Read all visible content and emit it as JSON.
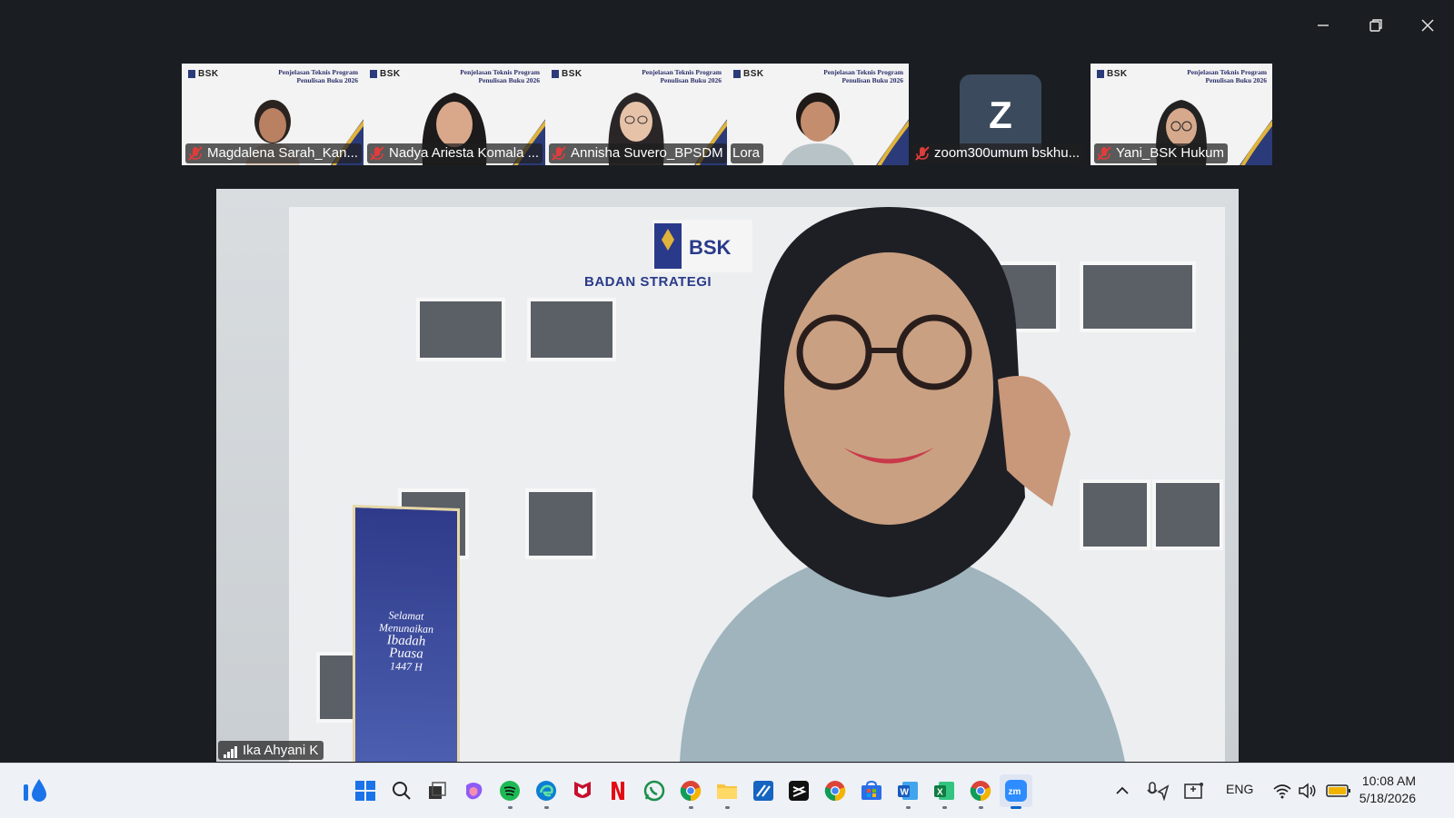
{
  "window": {
    "minimize_icon": "minimize-icon",
    "maximize_icon": "restore-icon",
    "close_icon": "close-icon"
  },
  "slide": {
    "logo": "BSK",
    "title_line1": "Penjelasan Teknis Program",
    "title_line2": "Penulisan Buku 2026"
  },
  "participants": [
    {
      "name": "Magdalena Sarah_Kan...",
      "muted": true
    },
    {
      "name": "Nadya Ariesta Komala ...",
      "muted": true
    },
    {
      "name": "Annisha Suvero_BPSDM",
      "muted": true
    },
    {
      "name": "Lora",
      "muted": false
    },
    {
      "name": "zoom300umum bskhu...",
      "muted": true,
      "avatar_letter": "Z"
    },
    {
      "name": "Yani_BSK Hukum",
      "muted": true
    }
  ],
  "speaker": {
    "name": "Ika Ahyani K",
    "building_sign": "BADAN STRATEGI",
    "building_logo": "BSK",
    "banner_text_1": "Selamat",
    "banner_text_2": "Menunaikan",
    "banner_text_3": "Ibadah",
    "banner_text_4": "Puasa",
    "banner_text_5": "1447 H"
  },
  "taskbar": {
    "apps": [
      "start-icon",
      "search-icon",
      "task-view-icon",
      "copilot-icon",
      "spotify-icon",
      "edge-icon",
      "mcafee-icon",
      "netflix-icon",
      "whatsapp-icon",
      "chrome-icon",
      "file-explorer-icon",
      "remote-icon",
      "capcut-icon",
      "chrome-profile-icon",
      "microsoft-store-icon",
      "word-icon",
      "excel-icon",
      "chrome-alt-icon",
      "zoom-icon"
    ],
    "language": "ENG",
    "time": "10:08 AM",
    "date": "5/18/2026"
  },
  "colors": {
    "background": "#1a1d21",
    "taskbar": "#eef1f6",
    "accent": "#0a64c8",
    "slide_navy": "#2b3a78",
    "slide_gold": "#e0b33a"
  }
}
